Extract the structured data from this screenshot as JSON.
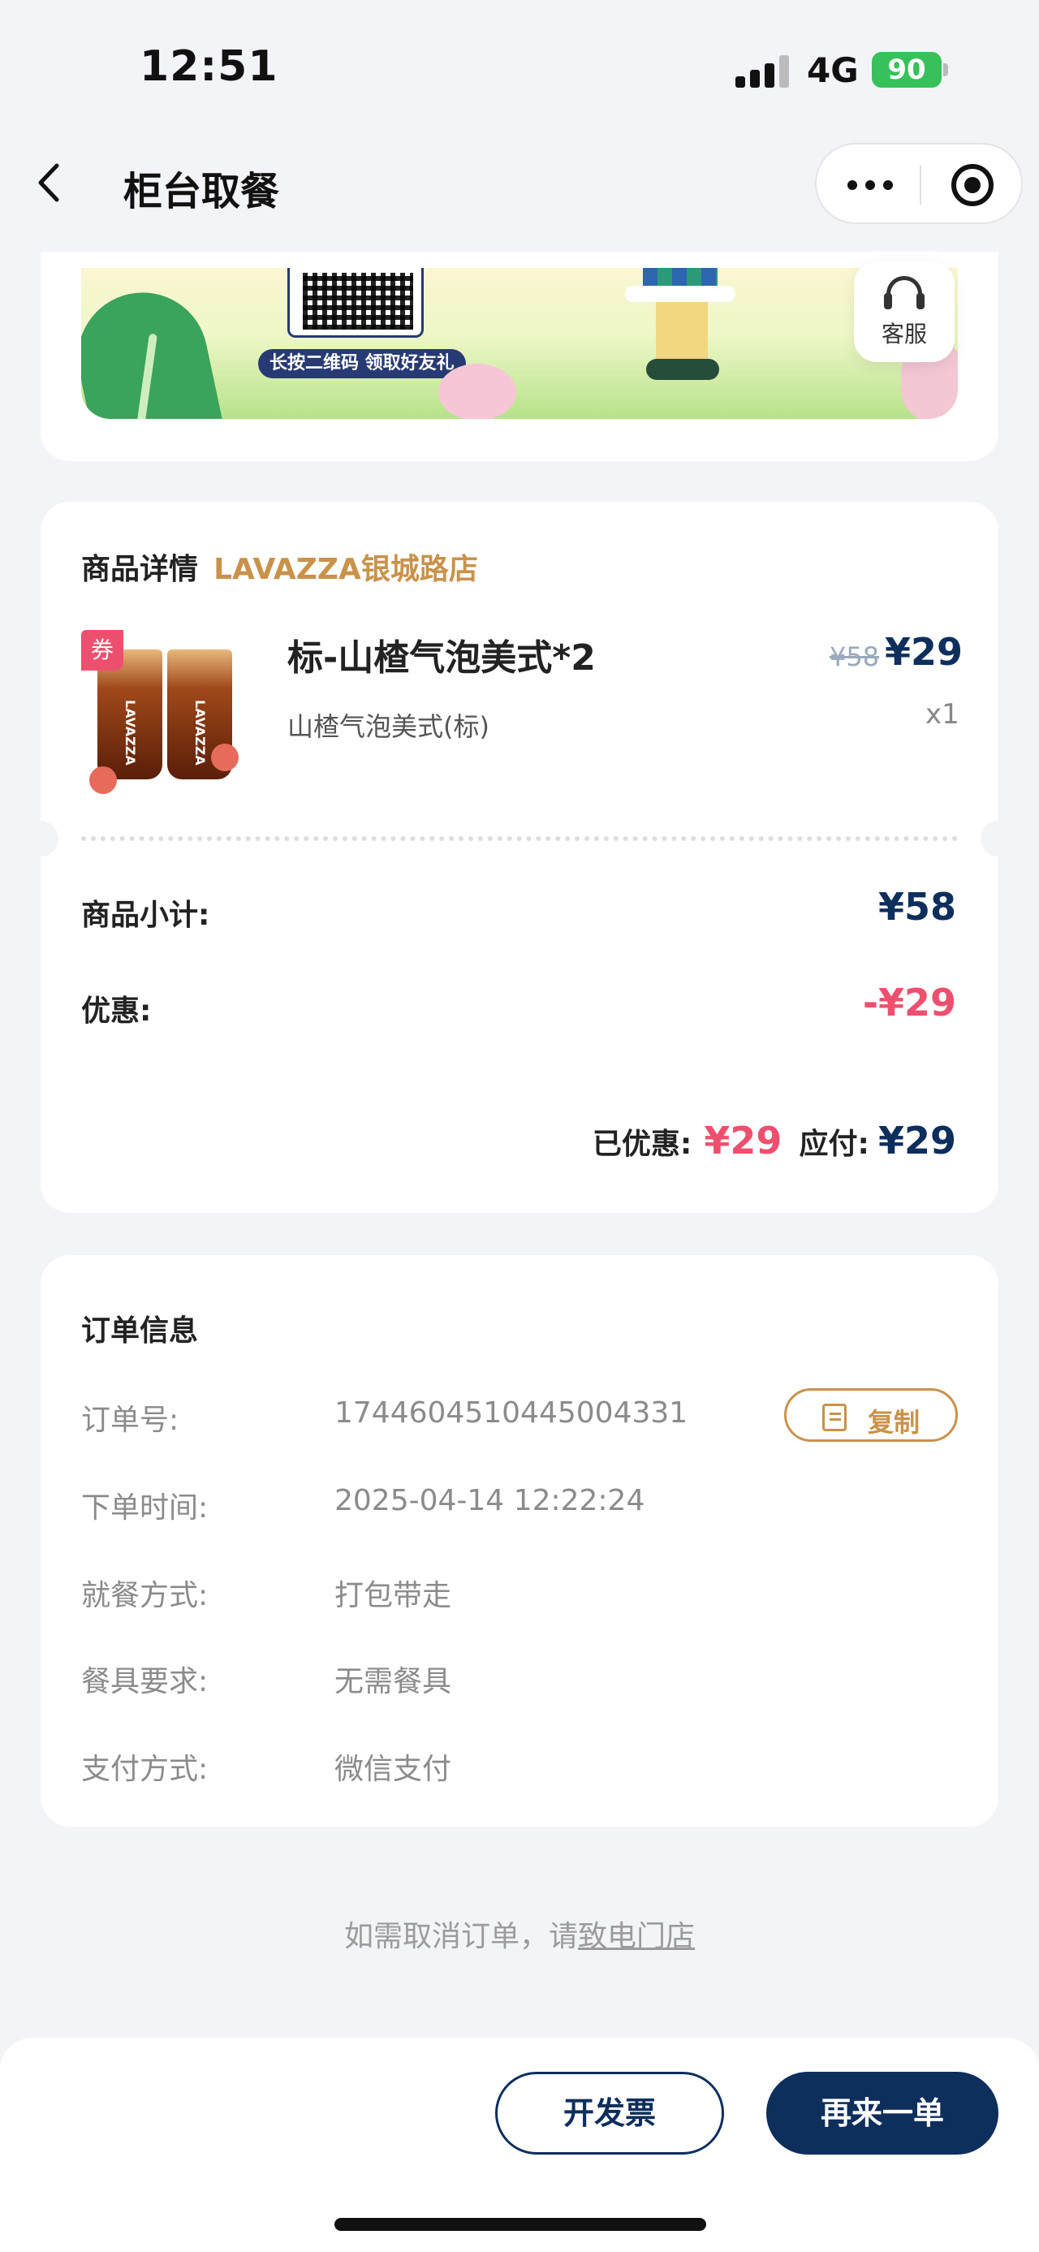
{
  "status_bar": {
    "time": "12:51",
    "network": "4G",
    "battery": "90"
  },
  "nav": {
    "title": "柜台取餐"
  },
  "banner": {
    "qr_caption": "长按二维码 领取好友礼",
    "service_label": "客服"
  },
  "goods": {
    "section_title": "商品详情",
    "store_name": "LAVAZZA银城路店",
    "coupon_badge": "券",
    "product_name": "标-山楂气泡美式*2",
    "product_spec": "山楂气泡美式(标)",
    "original_price": "¥58",
    "price": "¥29",
    "quantity": "x1",
    "subtotal_label": "商品小计:",
    "subtotal_value": "¥58",
    "discount_label": "优惠:",
    "discount_value": "-¥29",
    "saved_label": "已优惠:",
    "saved_value": "¥29",
    "payable_label": "应付:",
    "payable_value": "¥29"
  },
  "order_info": {
    "title": "订单信息",
    "copy_label": "复制",
    "rows": [
      {
        "label": "订单号:",
        "value": "1744604510445004331"
      },
      {
        "label": "下单时间:",
        "value": "2025-04-14 12:22:24"
      },
      {
        "label": "就餐方式:",
        "value": "打包带走"
      },
      {
        "label": "餐具要求:",
        "value": "无需餐具"
      },
      {
        "label": "支付方式:",
        "value": "微信支付"
      }
    ]
  },
  "cancel_note": {
    "text": "如需取消订单，请",
    "link": "致电门店"
  },
  "actions": {
    "invoice": "开发票",
    "reorder": "再来一单"
  },
  "colors": {
    "navy": "#0e2e5c",
    "gold": "#c9924a",
    "red": "#ee4f6e",
    "green": "#36c15a"
  },
  "icons": [
    "signal-icon",
    "battery-icon",
    "back-arrow-icon",
    "more-icon",
    "target-icon",
    "headset-icon",
    "copy-icon",
    "qr-code-icon"
  ]
}
